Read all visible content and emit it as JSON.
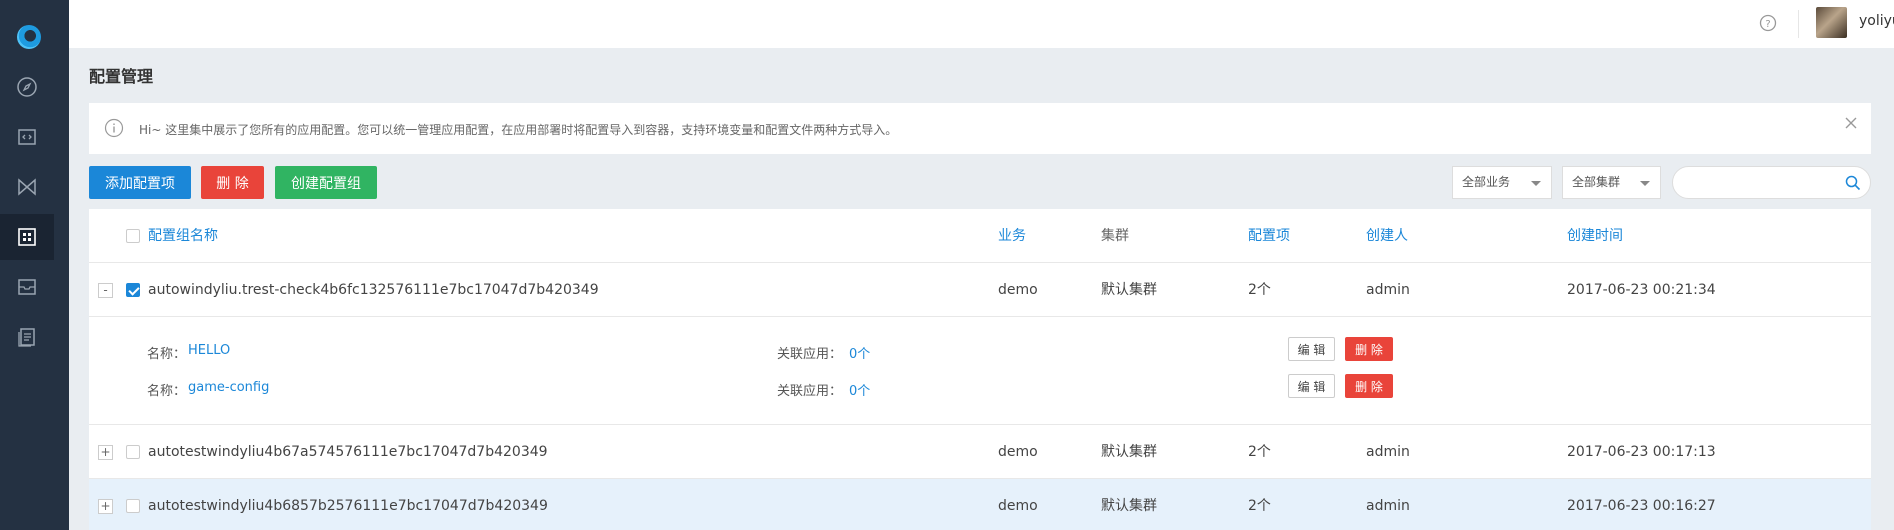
{
  "colors": {
    "primary": "#1b87d8",
    "danger": "#e9443a",
    "success": "#30b462",
    "sidebar": "#243142"
  },
  "sidebar": {
    "logo_icon": "app-logo",
    "items": [
      {
        "icon": "compass-icon"
      },
      {
        "icon": "code-icon"
      },
      {
        "icon": "bowtie-icon"
      },
      {
        "icon": "config-grid-icon",
        "active": true
      },
      {
        "icon": "archive-icon"
      },
      {
        "icon": "docs-icon"
      }
    ]
  },
  "header": {
    "help_icon": "help-icon",
    "username": "yoliyuan"
  },
  "page": {
    "title": "配置管理"
  },
  "notice": {
    "text": "Hi~ 这里集中展示了您所有的应用配置。您可以统一管理应用配置，在应用部署时将配置导入到容器，支持环境变量和配置文件两种方式导入。"
  },
  "toolbar": {
    "add_label": "添加配置项",
    "delete_label": "删 除",
    "create_group_label": "创建配置组",
    "business_filter": "全部业务",
    "cluster_filter": "全部集群",
    "search_placeholder": ""
  },
  "table": {
    "headers": {
      "name": "配置组名称",
      "business": "业务",
      "cluster": "集群",
      "items": "配置项",
      "creator": "创建人",
      "created": "创建时间"
    },
    "rows": [
      {
        "expander": "-",
        "checked": true,
        "name": "autowindyliu.trest-check4b6fc132576111e7bc17047d7b420349",
        "business": "demo",
        "cluster": "默认集群",
        "items": "2个",
        "creator": "admin",
        "created": "2017-06-23 00:21:34"
      },
      {
        "expander": "+",
        "checked": false,
        "name": "autotestwindyliu4b67a574576111e7bc17047d7b420349",
        "business": "demo",
        "cluster": "默认集群",
        "items": "2个",
        "creator": "admin",
        "created": "2017-06-23 00:17:13"
      },
      {
        "expander": "+",
        "checked": false,
        "name": "autotestwindyliu4b6857b2576111e7bc17047d7b420349",
        "business": "demo",
        "cluster": "默认集群",
        "items": "2个",
        "creator": "admin",
        "created": "2017-06-23 00:16:27"
      }
    ],
    "detail": [
      {
        "name_label": "名称：",
        "name": "HELLO",
        "app_label": "关联应用：",
        "app_count": "0个",
        "edit": "编 辑",
        "delete": "删 除"
      },
      {
        "name_label": "名称：",
        "name": "game-config",
        "app_label": "关联应用：",
        "app_count": "0个",
        "edit": "编 辑",
        "delete": "删 除"
      }
    ]
  }
}
